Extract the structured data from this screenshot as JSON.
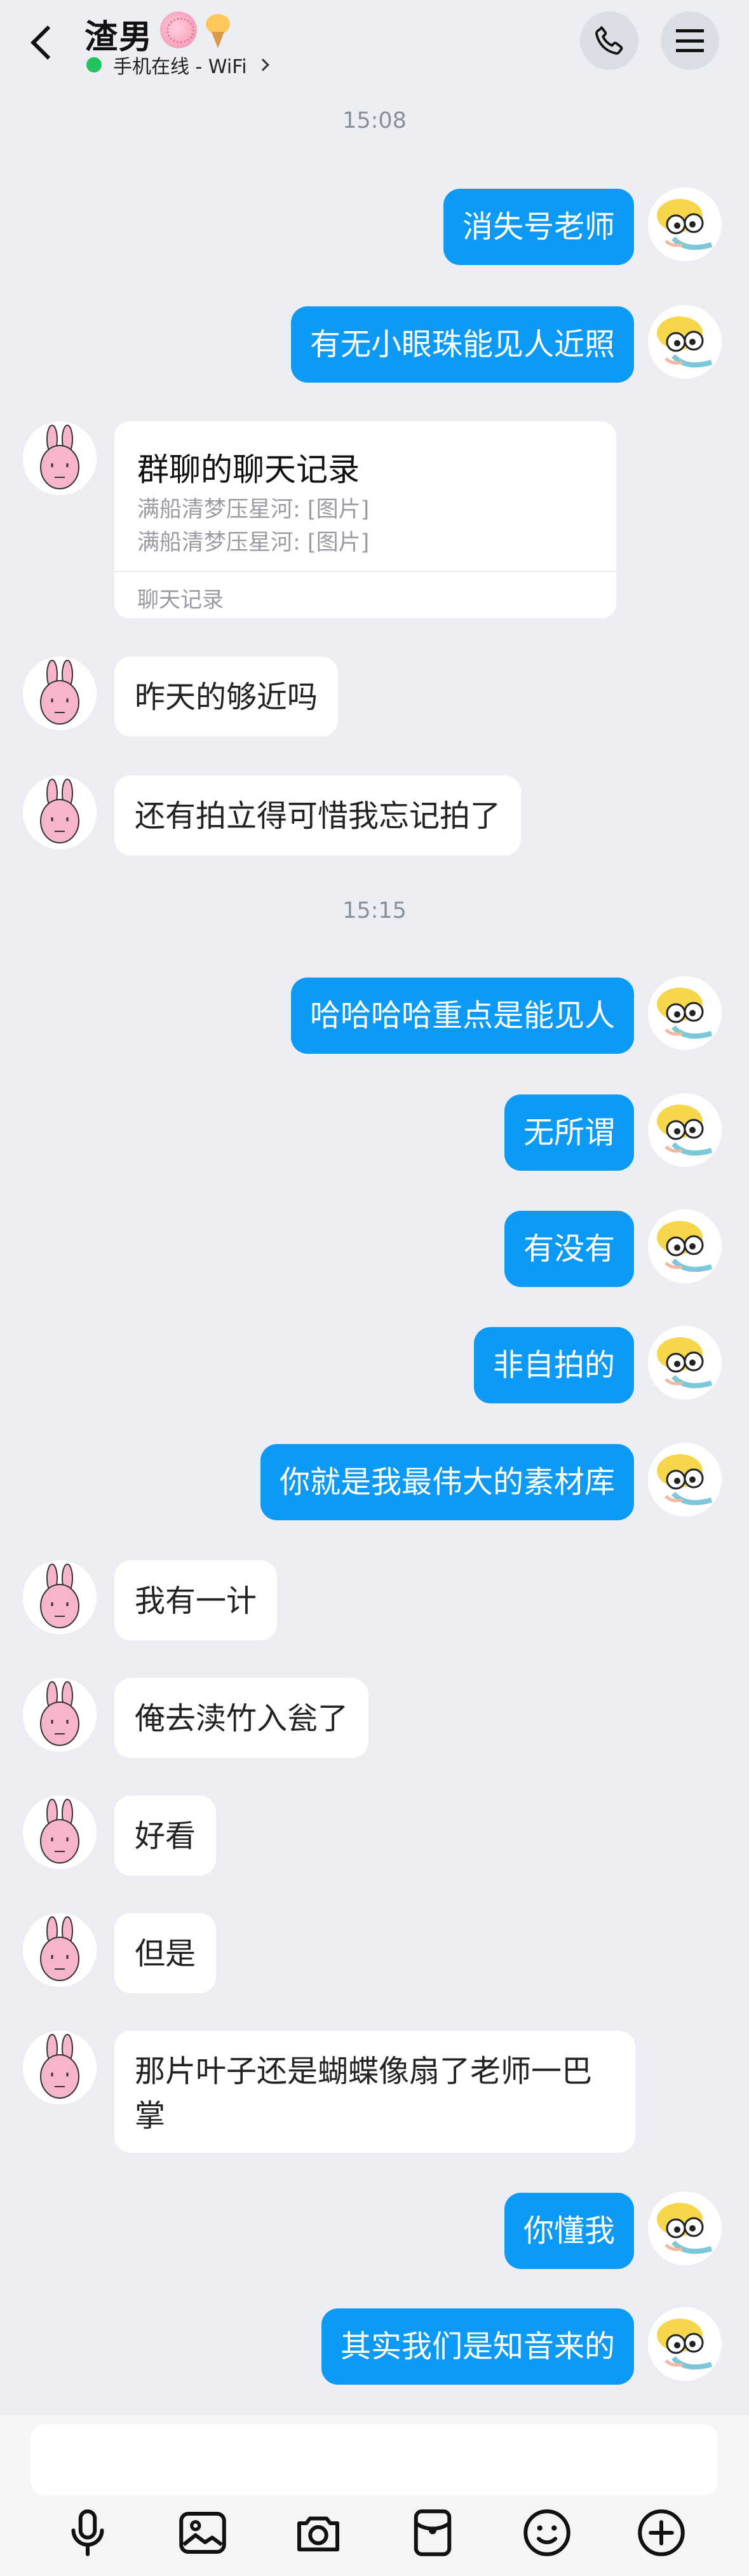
{
  "header": {
    "title": "渣男",
    "status_text": "手机在线 - WiFi",
    "badges": [
      "brain-badge",
      "ice-cream-badge"
    ],
    "icons": {
      "back": "back-arrow-icon",
      "call": "phone-icon",
      "menu": "menu-icon"
    }
  },
  "timestamps": [
    "15:08",
    "15:15"
  ],
  "messages": [
    {
      "dir": "out",
      "text": "消失号老师"
    },
    {
      "dir": "out",
      "text": "有无小眼珠能见人近照"
    },
    {
      "dir": "in",
      "type": "forward-card",
      "title": "群聊的聊天记录",
      "lines": [
        "满船清梦压星河: [图片]",
        "满船清梦压星河: [图片]"
      ],
      "footer": "聊天记录"
    },
    {
      "dir": "in",
      "text": "昨天的够近吗"
    },
    {
      "dir": "in",
      "text": "还有拍立得可惜我忘记拍了"
    },
    {
      "dir": "out",
      "text": "哈哈哈哈重点是能见人"
    },
    {
      "dir": "out",
      "text": "无所谓"
    },
    {
      "dir": "out",
      "text": "有没有"
    },
    {
      "dir": "out",
      "text": "非自拍的"
    },
    {
      "dir": "out",
      "text": "你就是我最伟大的素材库"
    },
    {
      "dir": "in",
      "text": "我有一计"
    },
    {
      "dir": "in",
      "text": "俺去渎竹入瓮了"
    },
    {
      "dir": "in",
      "text": "好看"
    },
    {
      "dir": "in",
      "text": "但是"
    },
    {
      "dir": "in",
      "text": "那片叶子还是蝴蝶像扇了老师一巴掌"
    },
    {
      "dir": "out",
      "text": "你懂我"
    },
    {
      "dir": "out",
      "text": "其实我们是知音来的"
    }
  ],
  "input": {
    "placeholder": ""
  },
  "toolbar": [
    "microphone-icon",
    "image-icon",
    "camera-icon",
    "red-packet-icon",
    "emoji-icon",
    "plus-icon"
  ],
  "colors": {
    "outgoing_bubble": "#0d9af7",
    "background": "#eceef4",
    "online": "#23c45e"
  }
}
